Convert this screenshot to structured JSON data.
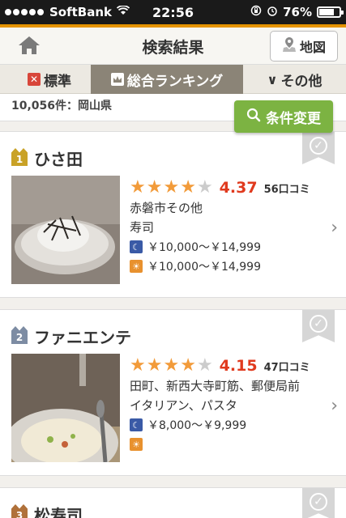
{
  "status_bar": {
    "carrier": "SoftBank",
    "time": "22:56",
    "battery": "76%",
    "battery_level": 0.76
  },
  "nav": {
    "title": "検索結果",
    "map_label": "地図"
  },
  "tabs": [
    {
      "label": "標準"
    },
    {
      "label": "総合ランキング"
    },
    {
      "label": "その他"
    }
  ],
  "result_count": "10,056件：岡山県",
  "condition_button": "条件変更",
  "colors": {
    "accent": "#e59400",
    "green": "#7cb342",
    "score": "#e03a1e"
  },
  "results": [
    {
      "rank": "1",
      "name": "ひさ田",
      "stars": 4,
      "score": "4.37",
      "reviews": "56口コミ",
      "area": "赤磐市その他",
      "genre": "寿司",
      "dinner_price": "￥10,000～￥14,999",
      "lunch_price": "￥10,000～￥14,999"
    },
    {
      "rank": "2",
      "name": "ファニエンテ",
      "stars": 4,
      "score": "4.15",
      "reviews": "47口コミ",
      "area": "田町、新西大寺町筋、郵便局前",
      "genre": "イタリアン、パスタ",
      "dinner_price": "￥8,000～￥9,999",
      "lunch_price": ""
    },
    {
      "rank": "3",
      "name": "松寿司"
    }
  ]
}
